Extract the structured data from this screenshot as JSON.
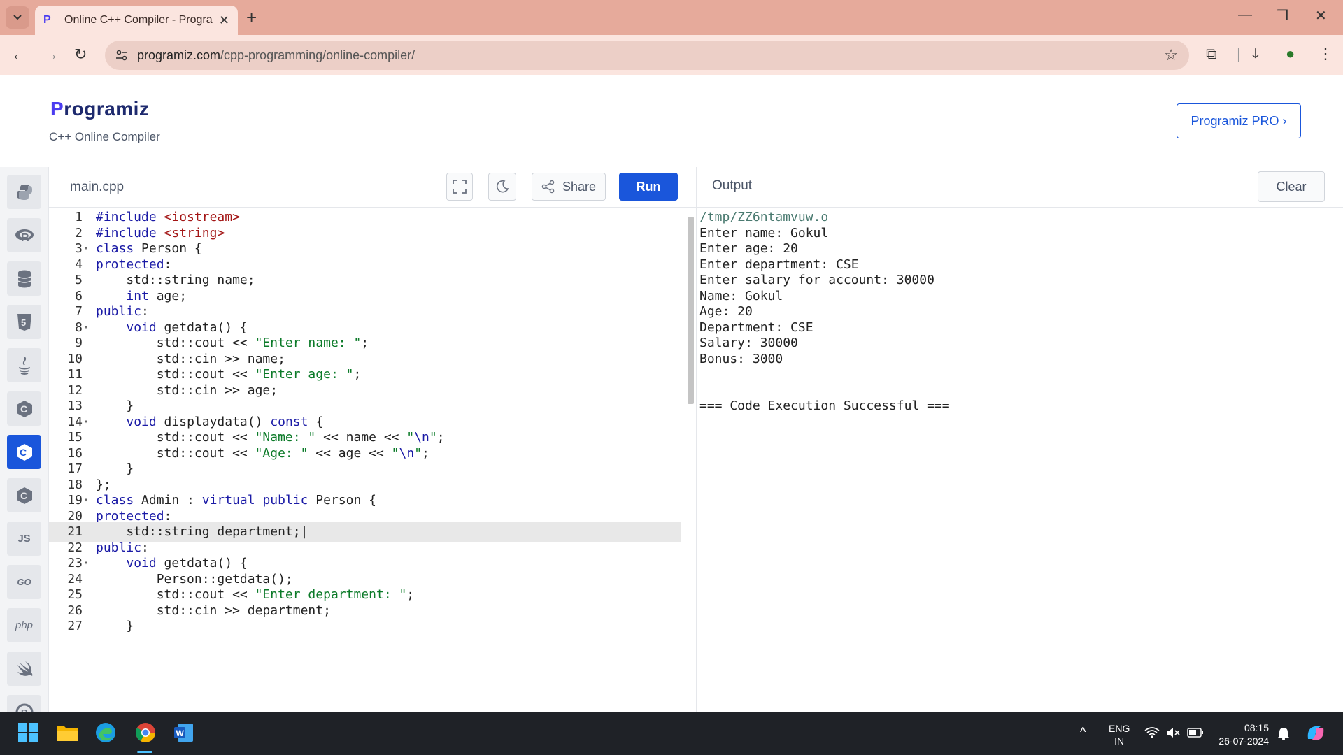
{
  "browser": {
    "tab_title": "Online C++ Compiler - Program",
    "url_domain": "programiz.com",
    "url_path": "/cpp-programming/online-compiler/"
  },
  "header": {
    "logo_text": "rogramiz",
    "logo_p": "P",
    "subtitle": "C++ Online Compiler",
    "pro_button": "Programiz PRO ›"
  },
  "sidebar": {
    "items": [
      "python",
      "r",
      "sql",
      "html",
      "java",
      "c",
      "cpp",
      "csharp",
      "JS",
      "GO",
      "php",
      "swift",
      "rust"
    ],
    "active": "cpp"
  },
  "editor": {
    "file_name": "main.cpp",
    "share_label": "Share",
    "run_label": "Run",
    "lines": [
      {
        "n": "1",
        "html": "<span class=\"kw\">#include</span> <span class=\"inc\">&lt;iostream&gt;</span>"
      },
      {
        "n": "2",
        "html": "<span class=\"kw\">#include</span> <span class=\"inc\">&lt;string&gt;</span>"
      },
      {
        "n": "3",
        "fold": true,
        "html": "<span class=\"kw\">class</span> Person {"
      },
      {
        "n": "4",
        "html": "<span class=\"kw\">protected</span>:"
      },
      {
        "n": "5",
        "html": "    std::string name;"
      },
      {
        "n": "6",
        "html": "    <span class=\"kw\">int</span> age;"
      },
      {
        "n": "7",
        "html": "<span class=\"kw\">public</span>:"
      },
      {
        "n": "8",
        "fold": true,
        "html": "    <span class=\"kw\">void</span> getdata() {"
      },
      {
        "n": "9",
        "html": "        std::cout &lt;&lt; <span class=\"str\">\"Enter name: \"</span>;"
      },
      {
        "n": "10",
        "html": "        std::cin &gt;&gt; name;"
      },
      {
        "n": "11",
        "html": "        std::cout &lt;&lt; <span class=\"str\">\"Enter age: \"</span>;"
      },
      {
        "n": "12",
        "html": "        std::cin &gt;&gt; age;"
      },
      {
        "n": "13",
        "html": "    }"
      },
      {
        "n": "14",
        "fold": true,
        "html": "    <span class=\"kw\">void</span> displaydata() <span class=\"kw\">const</span> {"
      },
      {
        "n": "15",
        "html": "        std::cout &lt;&lt; <span class=\"str\">\"Name: \"</span> &lt;&lt; name &lt;&lt; <span class=\"str\">\"<span class=\"kw\">\\n</span>\"</span>;"
      },
      {
        "n": "16",
        "html": "        std::cout &lt;&lt; <span class=\"str\">\"Age: \"</span> &lt;&lt; age &lt;&lt; <span class=\"str\">\"<span class=\"kw\">\\n</span>\"</span>;"
      },
      {
        "n": "17",
        "html": "    }"
      },
      {
        "n": "18",
        "html": "};"
      },
      {
        "n": "19",
        "fold": true,
        "html": "<span class=\"kw\">class</span> Admin : <span class=\"kw\">virtual</span> <span class=\"kw\">public</span> Person {"
      },
      {
        "n": "20",
        "html": "<span class=\"kw\">protected</span>:"
      },
      {
        "n": "21",
        "hl": true,
        "html": "    std::string department;|"
      },
      {
        "n": "22",
        "html": "<span class=\"kw\">public</span>:"
      },
      {
        "n": "23",
        "fold": true,
        "html": "    <span class=\"kw\">void</span> getdata() {"
      },
      {
        "n": "24",
        "html": "        Person::getdata();"
      },
      {
        "n": "25",
        "html": "        std::cout &lt;&lt; <span class=\"str\">\"Enter department: \"</span>;"
      },
      {
        "n": "26",
        "html": "        std::cin &gt;&gt; department;"
      },
      {
        "n": "27",
        "html": "    }"
      }
    ]
  },
  "output": {
    "title": "Output",
    "clear_label": "Clear",
    "lines": [
      "/tmp/ZZ6ntamvuw.o",
      "Enter name: Gokul",
      "Enter age: 20",
      "Enter department: CSE",
      "Enter salary for account: 30000",
      "Name: Gokul",
      "Age: 20",
      "Department: CSE",
      "Salary: 30000",
      "Bonus: 3000",
      "",
      "",
      "=== Code Execution Successful ==="
    ]
  },
  "taskbar": {
    "lang_top": "ENG",
    "lang_bottom": "IN",
    "time": "08:15",
    "date": "26-07-2024"
  },
  "colors": {
    "accent": "#1a56db",
    "tabbar": "#e6aa9b"
  }
}
